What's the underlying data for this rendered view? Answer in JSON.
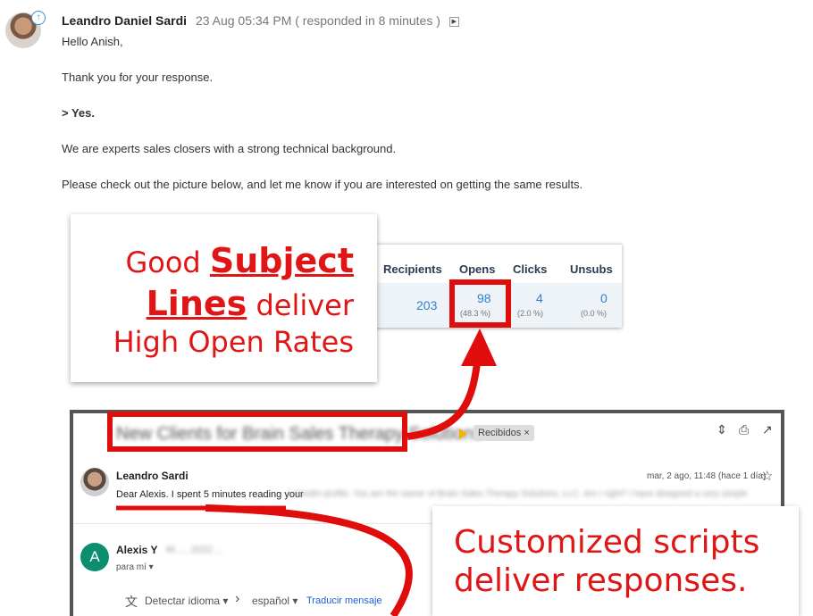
{
  "message": {
    "sender": "Leandro Daniel Sardi",
    "meta": "23 Aug 05:34 PM ( responded in 8 minutes )",
    "lines": [
      "Hello Anish,",
      "Thank you for your response.",
      "> Yes.",
      "We are experts sales closers with a strong technical background.",
      "Please check out the picture below, and let me know if you are interested on getting the same results."
    ]
  },
  "stats": {
    "headers": [
      "Recipients",
      "Opens",
      "Clicks",
      "Unsubs"
    ],
    "values": [
      "203",
      "98",
      "4",
      "0"
    ],
    "percents": [
      "(48.3 %)",
      "(2.0 %)",
      "(0.0 %)"
    ]
  },
  "callout1": {
    "good": "Good",
    "subject": "Subject",
    "lines": "Lines",
    "deliver": "deliver",
    "line3": "High Open Rates"
  },
  "gmail": {
    "subject_blurred": "New Clients for Brain Sales Therapy Solutions",
    "label": "Recibidos",
    "label_close": "×",
    "sender1": "Leandro Sardi",
    "date1": "mar, 2 ago, 11:48 (hace 1 día)",
    "snippet": "Dear Alexis. I spent 5 minutes reading your",
    "snippet_blurred": "LinkedIn profile. You are the owner of Brain Sales Therapy Solutions, LLC. Am I right? I have designed a very simple",
    "sender2": "Alexis Y",
    "sender2_blurred": "M...., 2022 ...",
    "to2": "para mí",
    "detect": "Detectar idioma",
    "lang": "español",
    "translate": "Traducir mensaje",
    "avatar2": "A"
  },
  "callout2": {
    "line1": "Customized scripts",
    "line2": "deliver responses."
  },
  "colors": {
    "accent_red": "#e01515",
    "link_blue": "#2e7fd1"
  }
}
